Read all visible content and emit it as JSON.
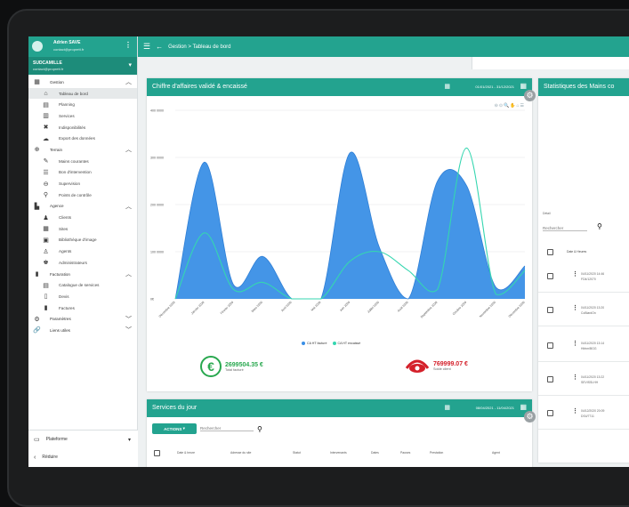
{
  "sidebar": {
    "user_name": "Adrien SAVE",
    "user_email": "contact@proprett.fr",
    "company_name": "SUDCAMILLE",
    "company_email": "contact@proprett.fr",
    "menu_glyph": "⋮",
    "sections": [
      {
        "label": "Gestion",
        "icon": "gestion-icon",
        "children": [
          {
            "label": "Tableau de bord",
            "icon": "dashboard-icon"
          },
          {
            "label": "Planning",
            "icon": "planning-icon"
          },
          {
            "label": "Services",
            "icon": "services-icon"
          },
          {
            "label": "Indisponibilités",
            "icon": "unavailable-icon"
          },
          {
            "label": "Export des données",
            "icon": "export-icon"
          }
        ]
      },
      {
        "label": "Terrain",
        "icon": "terrain-icon",
        "children": [
          {
            "label": "Mains courantes",
            "icon": "pen-icon"
          },
          {
            "label": "Bon d'intervention",
            "icon": "list-icon"
          },
          {
            "label": "Supervision",
            "icon": "supervision-icon"
          },
          {
            "label": "Points de contrôle",
            "icon": "pin-icon"
          }
        ]
      },
      {
        "label": "Agence",
        "icon": "agence-icon",
        "children": [
          {
            "label": "Clients",
            "icon": "clients-icon"
          },
          {
            "label": "Sites",
            "icon": "sites-icon"
          },
          {
            "label": "Bibliothèque d'image",
            "icon": "image-icon"
          },
          {
            "label": "Agents",
            "icon": "agents-icon"
          },
          {
            "label": "Administrateurs",
            "icon": "admins-icon"
          }
        ]
      },
      {
        "label": "Facturation",
        "icon": "facturation-icon",
        "children": [
          {
            "label": "Catalogue de services",
            "icon": "catalog-icon"
          },
          {
            "label": "Devis",
            "icon": "quote-icon"
          },
          {
            "label": "Factures",
            "icon": "invoice-icon"
          }
        ]
      }
    ],
    "extra": [
      {
        "label": "Paramètres",
        "icon": "settings-icon"
      },
      {
        "label": "Liens utiles",
        "icon": "link-icon"
      }
    ],
    "footer_platform": "Plateforme",
    "footer_back": "Réduire"
  },
  "topbar": {
    "breadcrumb": "Gestion  >  Tableau de bord"
  },
  "chart_card": {
    "title": "Chiffre d'affaires validé & encaissé",
    "date_range": "01/01/2021 - 31/12/2021",
    "toolbar_glyphs": "⊖⊙🔍✋⌂☰"
  },
  "chart_data": {
    "type": "area",
    "x": [
      "Décembre 2019",
      "Janvier 2020",
      "Février 2020",
      "Mars 2020",
      "Avril 2020",
      "Mai 2020",
      "Juin 2020",
      "Juillet 2020",
      "Août 2020",
      "Septembre 2020",
      "Octobre 2020",
      "Novembre 2020",
      "Décembre 2020"
    ],
    "series": [
      {
        "name": "CA HT facturé",
        "color": "#3a8fe6",
        "values": [
          0,
          290000,
          30000,
          90000,
          0,
          0,
          310000,
          110000,
          0,
          250000,
          240000,
          25000,
          70000
        ]
      },
      {
        "name": "CA HT encaissé",
        "color": "#35d6b0",
        "values": [
          0,
          140000,
          20000,
          35000,
          0,
          0,
          80000,
          100000,
          60000,
          20000,
          320000,
          10000,
          60000
        ]
      }
    ],
    "ylabel_ticks": [
      "400 0000",
      "300 0000",
      "200 0000",
      "100 0000",
      "0€"
    ],
    "ylim": [
      0,
      400000
    ],
    "grid": true,
    "legend": "bottom-center"
  },
  "kpis": [
    {
      "value": "2699504.35 €",
      "label": "Total facturé",
      "color": "#29a84f",
      "icon": "euro-icon"
    },
    {
      "value": "769999.07 €",
      "label": "Solde client",
      "color": "#d4202a",
      "icon": "eye-icon"
    }
  ],
  "services_card": {
    "title": "Services du jour",
    "date_range": "08/04/2021 - 11/04/2021",
    "actions_label": "ACTIONS",
    "search_placeholder": "Rechercher",
    "columns": [
      "Date & heure",
      "Adresse du site",
      "Statut",
      "Intervenants",
      "Dates",
      "Pauses",
      "Prestation",
      "Agent"
    ]
  },
  "stats_card": {
    "title": "Statistiques des Mains co",
    "subtitle": "Détail",
    "search_placeholder": "Rechercher",
    "column": "Date & Heures",
    "rows": [
      {
        "line1": "04/11/2020 14:46",
        "line2": "FD4/12070"
      },
      {
        "line1": "04/11/2020 13:20",
        "line2": "CoBiardOn"
      },
      {
        "line1": "04/11/2020 13:14",
        "line2": "Hbhm/BGG"
      },
      {
        "line1": "04/11/2020 13:22",
        "line2": "SEVISSLHH"
      },
      {
        "line1": "04/12/2020 20:09",
        "line2": "DS4/7711"
      }
    ]
  }
}
